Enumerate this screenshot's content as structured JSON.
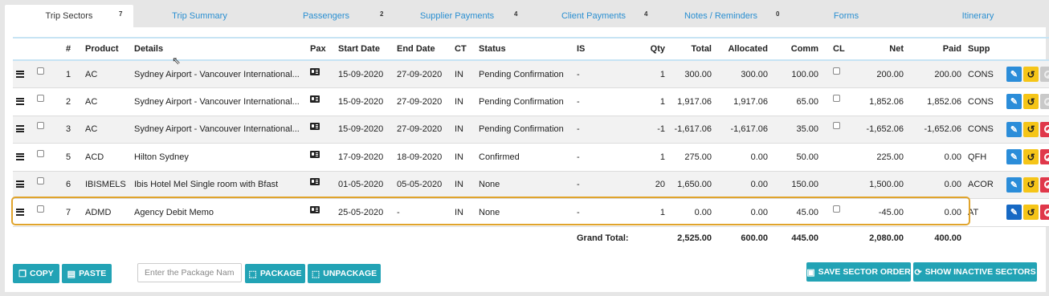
{
  "tabs": [
    {
      "label": "Trip Sectors",
      "badge": "7",
      "active": true
    },
    {
      "label": "Trip Summary",
      "badge": ""
    },
    {
      "label": "Passengers",
      "badge": "2"
    },
    {
      "label": "Supplier Payments",
      "badge": "4"
    },
    {
      "label": "Client Payments",
      "badge": "4"
    },
    {
      "label": "Notes / Reminders",
      "badge": "0"
    },
    {
      "label": "Forms",
      "badge": ""
    },
    {
      "label": "Itinerary",
      "badge": ""
    }
  ],
  "table": {
    "headers": {
      "num": "#",
      "product": "Product",
      "details": "Details",
      "pax": "Pax",
      "start": "Start Date",
      "end": "End Date",
      "ct": "CT",
      "status": "Status",
      "is": "IS",
      "qty": "Qty",
      "total": "Total",
      "allocated": "Allocated",
      "comm": "Comm",
      "cl": "CL",
      "net": "Net",
      "paid": "Paid",
      "supp": "Supp"
    },
    "rows": [
      {
        "num": "1",
        "product": "AC",
        "details": "Sydney Airport - Vancouver International...",
        "start": "15-09-2020",
        "end": "27-09-2020",
        "ct": "IN",
        "status": "Pending Confirmation",
        "is": "-",
        "qty": "1",
        "total": "300.00",
        "allocated": "300.00",
        "comm": "100.00",
        "net": "200.00",
        "paid": "200.00",
        "supp": "CONS",
        "delete_disabled": true
      },
      {
        "num": "2",
        "product": "AC",
        "details": "Sydney Airport - Vancouver International...",
        "start": "15-09-2020",
        "end": "27-09-2020",
        "ct": "IN",
        "status": "Pending Confirmation",
        "is": "-",
        "qty": "1",
        "total": "1,917.06",
        "allocated": "1,917.06",
        "comm": "65.00",
        "net": "1,852.06",
        "paid": "1,852.06",
        "supp": "CONS",
        "delete_disabled": true
      },
      {
        "num": "3",
        "product": "AC",
        "details": "Sydney Airport - Vancouver International...",
        "start": "15-09-2020",
        "end": "27-09-2020",
        "ct": "IN",
        "status": "Pending Confirmation",
        "is": "-",
        "qty": "-1",
        "total": "-1,617.06",
        "allocated": "-1,617.06",
        "comm": "35.00",
        "net": "-1,652.06",
        "paid": "-1,652.06",
        "supp": "CONS",
        "delete_disabled": false
      },
      {
        "num": "5",
        "product": "ACD",
        "details": "Hilton Sydney",
        "start": "17-09-2020",
        "end": "18-09-2020",
        "ct": "IN",
        "status": "Confirmed",
        "is": "-",
        "qty": "1",
        "total": "275.00",
        "allocated": "0.00",
        "comm": "50.00",
        "net": "225.00",
        "paid": "0.00",
        "supp": "QFH",
        "delete_disabled": false
      },
      {
        "num": "6",
        "product": "IBISMELS",
        "details": "Ibis Hotel Mel Single room with Bfast",
        "start": "01-05-2020",
        "end": "05-05-2020",
        "ct": "IN",
        "status": "None",
        "is": "-",
        "qty": "20",
        "total": "1,650.00",
        "allocated": "0.00",
        "comm": "150.00",
        "net": "1,500.00",
        "paid": "0.00",
        "supp": "ACOR",
        "delete_disabled": false
      },
      {
        "num": "7",
        "product": "ADMD",
        "details": "Agency Debit Memo",
        "start": "25-05-2020",
        "end": "-",
        "ct": "IN",
        "status": "None",
        "is": "-",
        "qty": "1",
        "total": "0.00",
        "allocated": "0.00",
        "comm": "45.00",
        "net": "-45.00",
        "paid": "0.00",
        "supp": "AT",
        "delete_disabled": false,
        "selected": true
      }
    ],
    "grand_total": {
      "label": "Grand Total:",
      "total": "2,525.00",
      "allocated": "600.00",
      "comm": "445.00",
      "net": "2,080.00",
      "paid": "400.00"
    }
  },
  "footer": {
    "copy_label": "COPY",
    "paste_label": "PASTE",
    "package_placeholder": "Enter the Package Name",
    "package_label": "PACKAGE",
    "unpackage_label": "UNPACKAGE",
    "save_order_label": "SAVE SECTOR ORDER",
    "show_inactive_label": "SHOW INACTIVE SECTORS"
  },
  "colors": {
    "accent": "#22a3b5",
    "tab_link": "#2a8fd1",
    "edit": "#2b8dd9",
    "undo": "#f5c518",
    "delete": "#e0384a",
    "highlight": "#e0a42c"
  },
  "icons": [
    "menu-icon",
    "checkbox-icon",
    "pax-card-icon",
    "edit-pencil-icon",
    "undo-icon",
    "delete-circle-icon",
    "copy-icon",
    "paste-icon",
    "package-icon",
    "unpackage-icon",
    "save-icon",
    "refresh-icon"
  ]
}
